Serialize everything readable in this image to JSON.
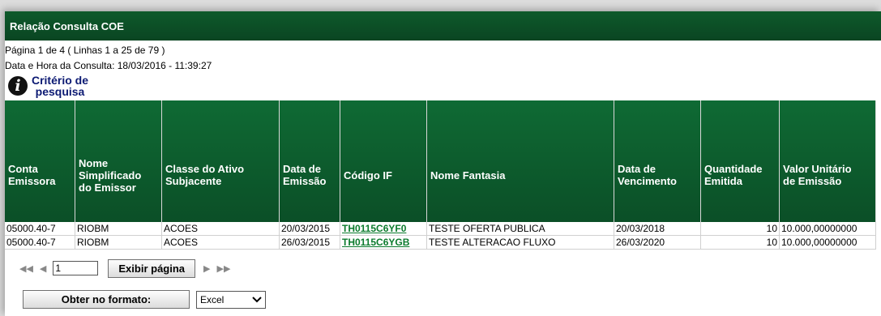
{
  "header": {
    "title": "Relação Consulta COE"
  },
  "info": {
    "pagination": "Página 1 de 4 ( Linhas 1 a 25 de 79 )",
    "datetime": "Data e Hora da Consulta: 18/03/2016 - 11:39:27"
  },
  "criteria": {
    "label_line1": "Critério de",
    "label_line2": "pesquisa",
    "icon": "info-icon"
  },
  "table": {
    "headers": [
      [
        "Conta",
        "Emissora"
      ],
      [
        "Nome",
        "Simplificado",
        "do Emissor"
      ],
      [
        "Classe do Ativo",
        "Subjacente"
      ],
      [
        "Data de",
        "Emissão"
      ],
      [
        "Código IF"
      ],
      [
        "Nome Fantasia"
      ],
      [
        "Data de",
        "Vencimento"
      ],
      [
        "Quantidade",
        "Emitida"
      ],
      [
        "Valor Unitário",
        "de Emissão"
      ]
    ],
    "rows": [
      [
        "05000.40-7",
        "RIOBM",
        "ACOES",
        "20/03/2015",
        "TH0115C6YF0",
        "TESTE OFERTA PUBLICA",
        "20/03/2018",
        "10",
        "10.000,00000000"
      ],
      [
        "05000.40-7",
        "RIOBM",
        "ACOES",
        "26/03/2015",
        "TH0115C6YGB",
        "TESTE ALTERACAO FLUXO",
        "26/03/2020",
        "10",
        "10.000,00000000"
      ]
    ]
  },
  "pager": {
    "first_icon": "first-page-icon",
    "prev_icon": "prev-page-icon",
    "next_icon": "next-page-icon",
    "last_icon": "last-page-icon",
    "page_value": "1",
    "button_label": "Exibir página"
  },
  "export": {
    "button_label": "Obter no formato:",
    "format_selected": "Excel"
  },
  "colors": {
    "header_green": "#0b5a2b",
    "link_green": "#0a7a2c",
    "criteria_blue": "#0c1a73"
  }
}
